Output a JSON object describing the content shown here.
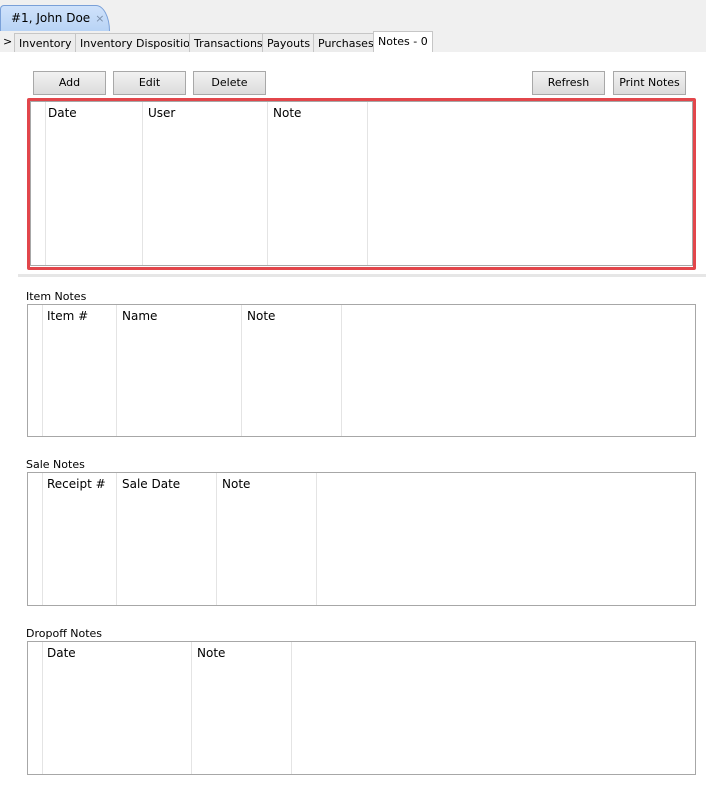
{
  "document_tab": {
    "title": "#1, John Doe",
    "close_glyph": "×"
  },
  "subtabs": {
    "arrow": ">",
    "items": [
      "Inventory",
      "Inventory Disposition",
      "Transactions",
      "Payouts",
      "Purchases",
      "Notes - 0"
    ],
    "active": "Notes - 0"
  },
  "toolbar": {
    "add": "Add",
    "edit": "Edit",
    "delete": "Delete",
    "refresh": "Refresh",
    "print_notes": "Print Notes"
  },
  "notes_grid": {
    "columns": [
      "Date",
      "User",
      "Note"
    ],
    "rows": []
  },
  "item_notes": {
    "label": "Item Notes",
    "columns": [
      "Item #",
      "Name",
      "Note"
    ],
    "rows": []
  },
  "sale_notes": {
    "label": "Sale Notes",
    "columns": [
      "Receipt #",
      "Sale Date",
      "Note"
    ],
    "rows": []
  },
  "dropoff_notes": {
    "label": "Dropoff Notes",
    "columns": [
      "Date",
      "Note"
    ],
    "rows": []
  },
  "colors": {
    "highlight": "#e2464b",
    "tab_active": "#b8d3f5"
  }
}
